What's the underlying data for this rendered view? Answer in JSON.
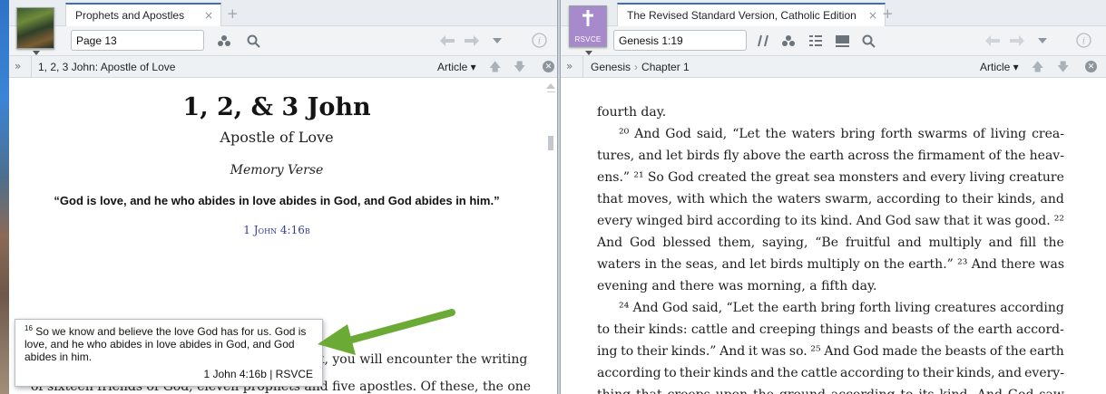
{
  "left_pane": {
    "tab_title": "Prophets and Apostles",
    "tab_close": "×",
    "tab_add": "+",
    "reference_value": "Page 13",
    "breadcrumb": "1, 2, 3 John: Apostle of Love",
    "article_label": "Article ▾",
    "expand_label": "»",
    "content": {
      "title": "1, 2, & 3 John",
      "subtitle": "Apostle of Love",
      "memory_heading": "Memory Verse",
      "memory_quote": "“God is love, and he who abides in love abides in God, and God abides in him.”",
      "memory_ref": "1 John 4:16b",
      "body_lines": [
        "k, you will encounter the writing",
        "of sixteen friends of God, eleven prophets and five apostles. Of these, the one"
      ]
    },
    "popup": {
      "verse_num": "16",
      "text": "So we know and believe the love God has for us. God is love, and he who abides in love abides in God, and God abides in him.",
      "reference": "1 John 4:16b | RSVCE"
    }
  },
  "right_pane": {
    "tab_title": "The Revised Standard Version, Catholic Edition",
    "tab_close": "×",
    "tab_add": "+",
    "cover_label": "RSVCE",
    "reference_value": "Genesis 1:19",
    "breadcrumb": [
      "Genesis",
      "Chapter 1"
    ],
    "breadcrumb_sep": "›",
    "article_label": "Article ▾",
    "expand_label": "»",
    "lines": [
      {
        "t": "fourth day.",
        "indent": false,
        "last": true
      },
      {
        "t": "²⁰ And God said, “Let the waters bring forth swarms of living crea-",
        "indent": true,
        "last": false
      },
      {
        "t": "tures, and let birds fly above the earth across the firmament of the heav-",
        "indent": false,
        "last": false
      },
      {
        "t": "ens.” ²¹ So God created the great sea monsters and every living creature",
        "indent": false,
        "last": false
      },
      {
        "t": "that moves, with which the waters swarm, according to their kinds, and",
        "indent": false,
        "last": false
      },
      {
        "t": "every winged bird according to its kind. And God saw that it was good. ²²",
        "indent": false,
        "last": false
      },
      {
        "t": "And God blessed them, saying, “Be fruitful and multiply and fill the",
        "indent": false,
        "last": false
      },
      {
        "t": "waters in the seas, and let birds multiply on the earth.” ²³ And there was",
        "indent": false,
        "last": false
      },
      {
        "t": "evening and there was morning, a fifth day.",
        "indent": false,
        "last": true
      },
      {
        "t": "²⁴ And God said, “Let the earth bring forth living creatures according",
        "indent": true,
        "last": false
      },
      {
        "t": "to their kinds: cattle and creeping things and beasts of the earth accord-",
        "indent": false,
        "last": false
      },
      {
        "t": "ing to their kinds.” And it was so. ²⁵ And God made the beasts of the earth",
        "indent": false,
        "last": false
      },
      {
        "t": "according to their kinds and the cattle according to their kinds, and every-",
        "indent": false,
        "last": false
      },
      {
        "t": "thing that creeps upon the ground according to its kind. And God saw",
        "indent": false,
        "last": false
      }
    ]
  },
  "colors": {
    "accent": "#3d6fb3",
    "link": "#2f3e9e",
    "arrow": "#6aaa35",
    "cover_purple": "#a68acb"
  },
  "icons": {
    "left_toolbar": [
      "parallel-resources-icon",
      "search-icon",
      "back-arrow-icon",
      "forward-arrow-icon",
      "history-dropdown-icon",
      "info-icon"
    ],
    "right_toolbar": [
      "parallel-lines-icon",
      "parallel-resources-icon",
      "visual-filters-icon",
      "text-display-icon",
      "search-icon",
      "back-arrow-icon",
      "forward-arrow-icon",
      "history-dropdown-icon",
      "info-icon"
    ]
  }
}
